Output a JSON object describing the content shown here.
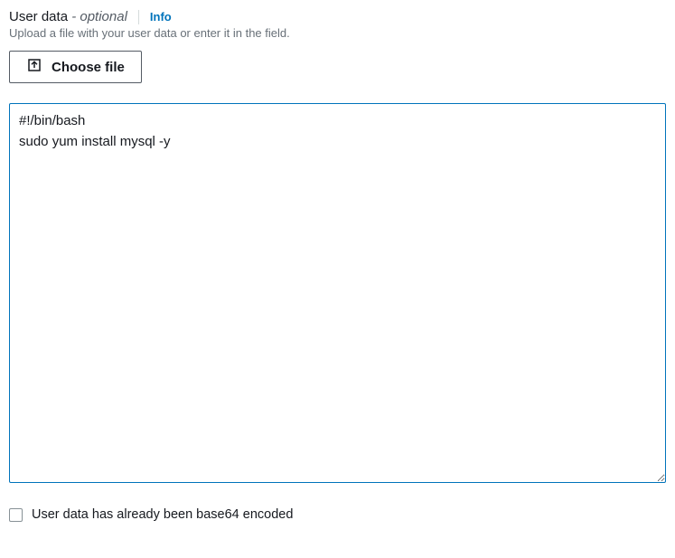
{
  "header": {
    "title": "User data",
    "optional_suffix": " - optional",
    "info_label": "Info"
  },
  "helper_text": "Upload a file with your user data or enter it in the field.",
  "choose_file": {
    "label": "Choose file"
  },
  "textarea": {
    "value": "#!/bin/bash\nsudo yum install mysql -y"
  },
  "checkbox": {
    "checked": false,
    "label": "User data has already been base64 encoded"
  }
}
